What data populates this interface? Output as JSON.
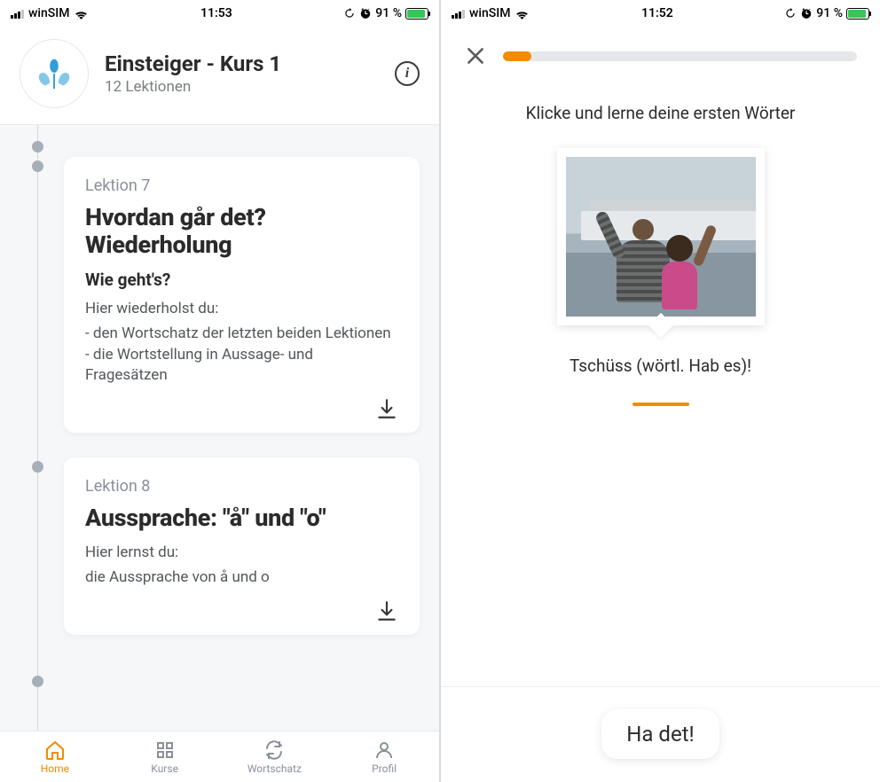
{
  "left": {
    "status": {
      "carrier": "winSIM",
      "time": "11:53",
      "battery": "91 %"
    },
    "header": {
      "title": "Einsteiger - Kurs 1",
      "subtitle": "12 Lektionen"
    },
    "lessons": [
      {
        "number": "Lektion 7",
        "title": "Hvordan går det? Wiederholung",
        "subtitle": "Wie geht's?",
        "intro": "Hier wiederholst du:",
        "body": "- den Wortschatz der letzten beiden Lektionen\n- die Wortstellung in Aussage- und Fragesätzen"
      },
      {
        "number": "Lektion 8",
        "title": "Aussprache: \"å\" und \"o\"",
        "intro": "Hier lernst du:",
        "body": "die Aussprache von å und o"
      }
    ],
    "tabs": [
      {
        "label": "Home"
      },
      {
        "label": "Kurse"
      },
      {
        "label": "Wortschatz"
      },
      {
        "label": "Profil"
      }
    ]
  },
  "right": {
    "status": {
      "carrier": "winSIM",
      "time": "11:52",
      "battery": "91 %"
    },
    "progress_pct": 8,
    "prompt": "Klicke und lerne deine ersten Wörter",
    "translation": "Tschüss (wörtl. Hab es)!",
    "answer": "Ha det!"
  }
}
